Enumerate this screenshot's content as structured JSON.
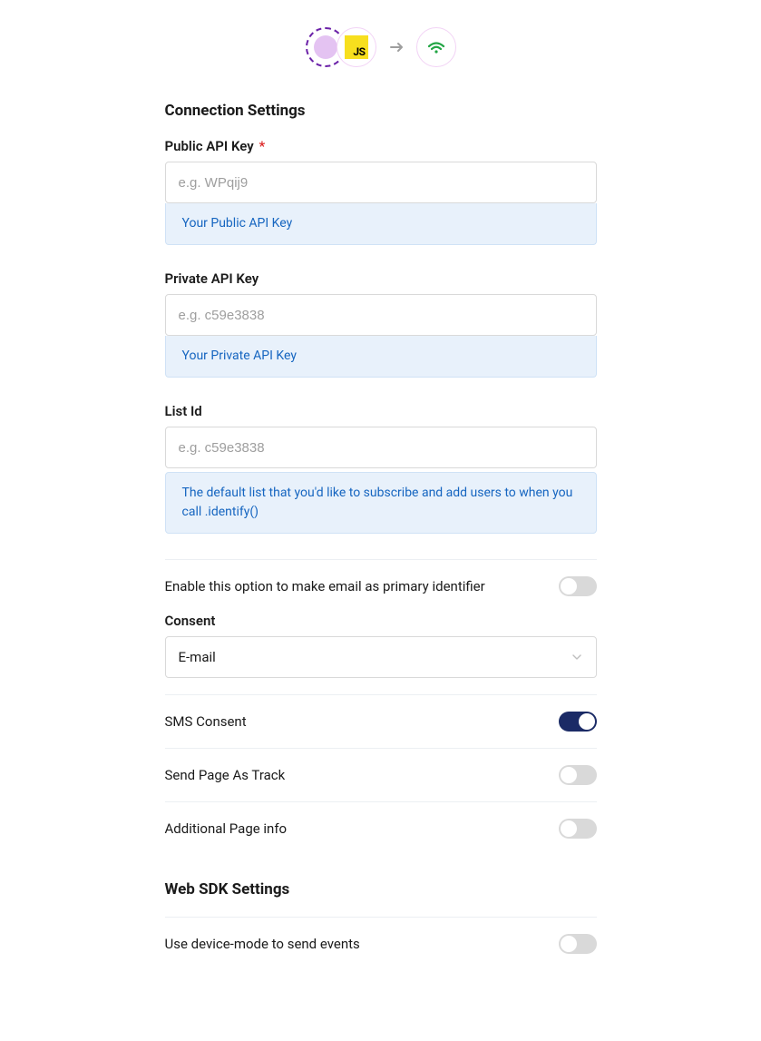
{
  "header": {
    "js_badge": "JS"
  },
  "sections": {
    "connection_title": "Connection Settings",
    "websdk_title": "Web SDK Settings"
  },
  "fields": {
    "public_api_key": {
      "label": "Public API Key",
      "required_marker": "*",
      "placeholder": "e.g. WPqij9",
      "hint": "Your Public API Key"
    },
    "private_api_key": {
      "label": "Private API Key",
      "placeholder": "e.g. c59e3838",
      "hint": "Your Private API Key"
    },
    "list_id": {
      "label": "List Id",
      "placeholder": "e.g. c59e3838",
      "hint": "The default list that you'd like to subscribe and add users to when you call .identify()"
    },
    "consent": {
      "label": "Consent",
      "selected": "E-mail"
    }
  },
  "toggles": {
    "email_primary": {
      "label": "Enable this option to make email as primary identifier",
      "on": false
    },
    "sms_consent": {
      "label": "SMS Consent",
      "on": true
    },
    "send_page_as_track": {
      "label": "Send Page As Track",
      "on": false
    },
    "additional_page_info": {
      "label": "Additional Page info",
      "on": false
    },
    "device_mode": {
      "label": "Use device-mode to send events",
      "on": false
    }
  }
}
